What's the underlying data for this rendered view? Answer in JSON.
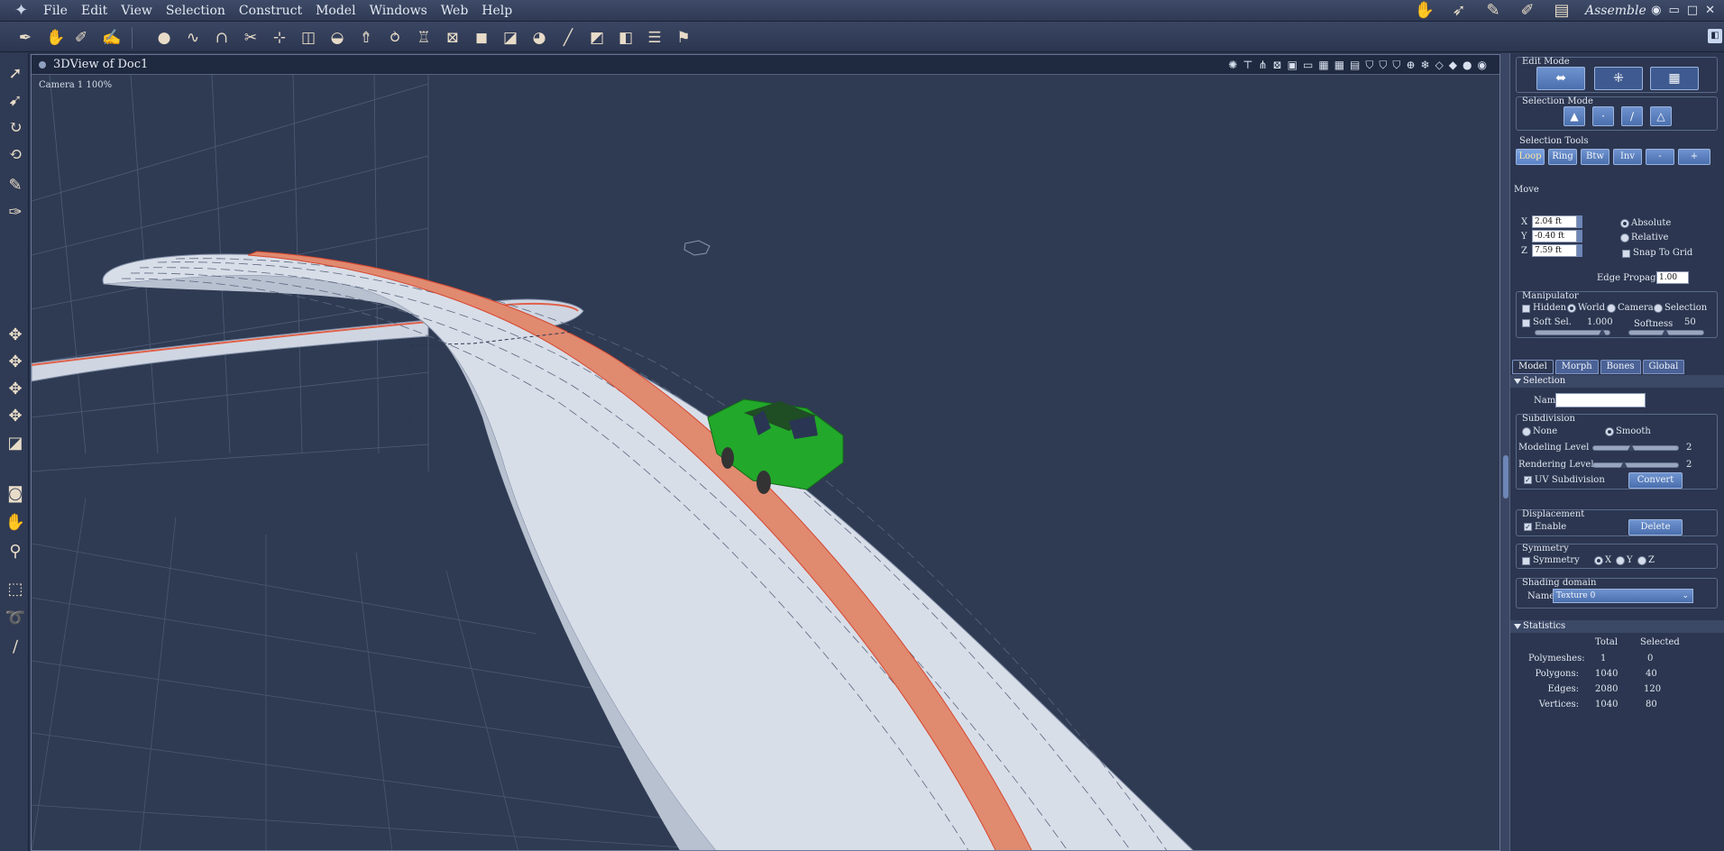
{
  "menubar": {
    "items": [
      "File",
      "Edit",
      "View",
      "Selection",
      "Construct",
      "Model",
      "Windows",
      "Web",
      "Help"
    ],
    "room_label": "Assemble"
  },
  "viewport": {
    "title": "3DView of Doc1",
    "camera_label": "Camera 1 100%"
  },
  "panel": {
    "edit_mode_title": "Edit Mode",
    "selection_mode_title": "Selection Mode",
    "selection_tools_title": "Selection Tools",
    "selection_tools": [
      "Loop",
      "Ring",
      "Btw",
      "Inv",
      "-",
      "+"
    ],
    "move_title": "Move",
    "move": {
      "x_label": "X",
      "x_value": "2.04 ft",
      "y_label": "Y",
      "y_value": "-0.40 ft",
      "z_label": "Z",
      "z_value": "7.59 ft",
      "absolute": "Absolute",
      "relative": "Relative",
      "snap_to_grid": "Snap To Grid",
      "edge_propagation_label": "Edge Propagation",
      "edge_propagation_value": "1.00"
    },
    "manipulator": {
      "title": "Manipulator",
      "hidden": "Hidden",
      "world": "World",
      "camera": "Camera",
      "selection": "Selection",
      "soft_sel": "Soft Sel.",
      "soft_sel_value": "1.000",
      "softness": "Softness",
      "softness_value": "50"
    },
    "tabs": [
      "Model",
      "Morph",
      "Bones",
      "Global"
    ],
    "selection_section": "Selection",
    "name_label": "Name",
    "name_value": "",
    "subdivision": {
      "title": "Subdivision",
      "none": "None",
      "smooth": "Smooth",
      "modeling_level": "Modeling Level",
      "modeling_value": "2",
      "rendering_level": "Rendering Level",
      "rendering_value": "2",
      "uv_subdivision": "UV Subdivision",
      "convert": "Convert"
    },
    "displacement": {
      "title": "Displacement",
      "enable": "Enable",
      "delete": "Delete"
    },
    "symmetry": {
      "title": "Symmetry",
      "label": "Symmetry",
      "x": "X",
      "y": "Y",
      "z": "Z"
    },
    "shading": {
      "title": "Shading domain",
      "name_label": "Name",
      "value": "Texture 0"
    },
    "statistics": {
      "title": "Statistics",
      "col_total": "Total",
      "col_selected": "Selected",
      "rows": [
        {
          "label": "Polymeshes:",
          "total": "1",
          "selected": "0"
        },
        {
          "label": "Polygons:",
          "total": "1040",
          "selected": "40"
        },
        {
          "label": "Edges:",
          "total": "2080",
          "selected": "120"
        },
        {
          "label": "Vertices:",
          "total": "1040",
          "selected": "80"
        }
      ]
    }
  },
  "colors": {
    "background": "#2f3b53",
    "road": "#d8dee8",
    "selected_edge": "#e08a70",
    "car": "#22a82a",
    "accent_button": "#5a7fc0"
  }
}
